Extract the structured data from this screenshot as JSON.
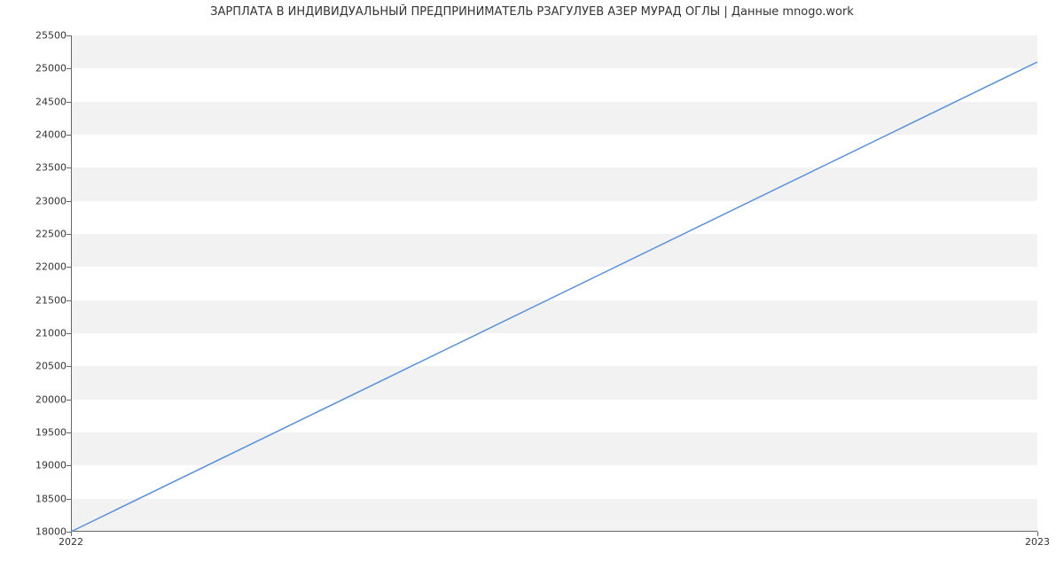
{
  "chart_data": {
    "type": "line",
    "title": "ЗАРПЛАТА В ИНДИВИДУАЛЬНЫЙ ПРЕДПРИНИМАТЕЛЬ РЗАГУЛУЕВ АЗЕР МУРАД ОГЛЫ | Данные mnogo.work",
    "x": [
      2022,
      2023
    ],
    "values": [
      18000,
      25100
    ],
    "x_tick_labels": [
      "2022",
      "2023"
    ],
    "y_tick_labels": [
      "18000",
      "18500",
      "19000",
      "19500",
      "20000",
      "20500",
      "21000",
      "21500",
      "22000",
      "22500",
      "23000",
      "23500",
      "24000",
      "24500",
      "25000",
      "25500"
    ],
    "ylim": [
      18000,
      25500
    ],
    "xlim": [
      2022,
      2023
    ],
    "line_color": "#5b8fd6",
    "xlabel": "",
    "ylabel": ""
  }
}
